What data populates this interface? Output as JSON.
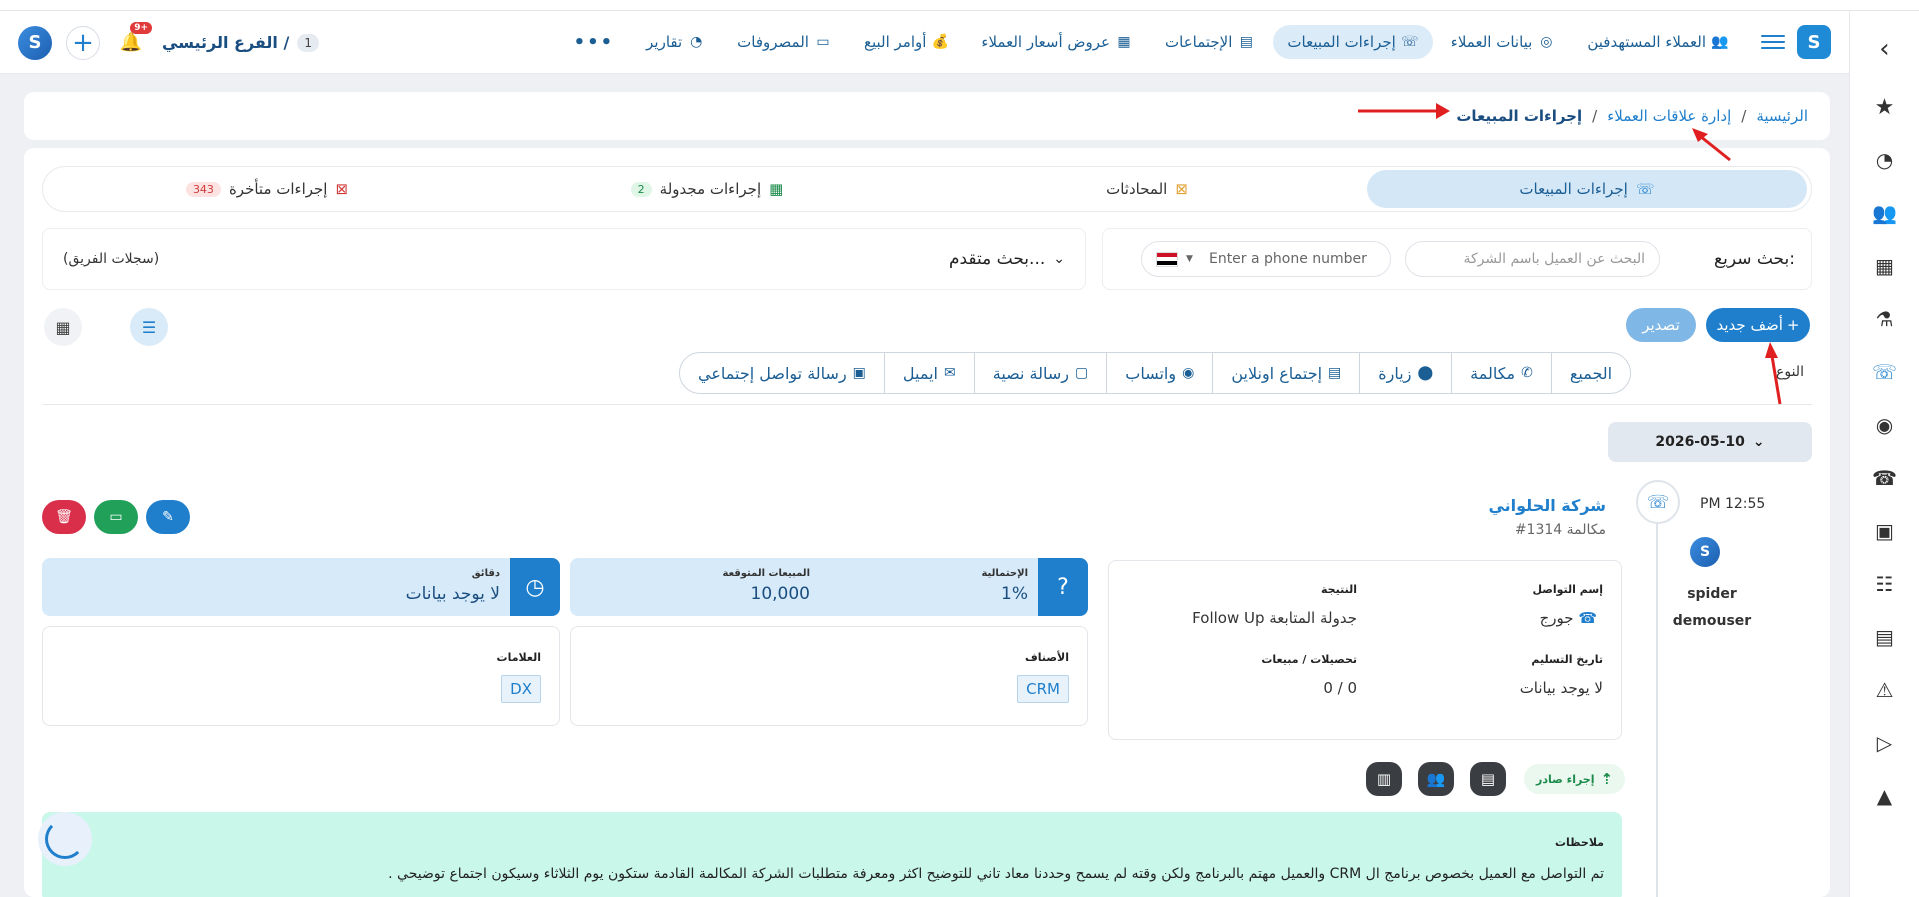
{
  "navbar": {
    "items": [
      {
        "label": "العملاء المستهدفين",
        "icon": "target-users-icon",
        "glyph": "👥"
      },
      {
        "label": "بيانات العملاء",
        "icon": "client-data-icon",
        "glyph": "◎"
      },
      {
        "label": "إجراءات المبيعات",
        "icon": "phone-icon",
        "glyph": "☏",
        "active": true
      },
      {
        "label": "الإجتماعات",
        "icon": "meetings-icon",
        "glyph": "▤"
      },
      {
        "label": "عروض أسعار العملاء",
        "icon": "price-quotes-icon",
        "glyph": "▦"
      },
      {
        "label": "أوامر البيع",
        "icon": "sales-orders-icon",
        "glyph": "💰"
      },
      {
        "label": "المصروفات",
        "icon": "expenses-icon",
        "glyph": "▭"
      },
      {
        "label": "تقارير",
        "icon": "reports-icon",
        "glyph": "◔"
      }
    ],
    "more": "•••",
    "branch_name": "الفرع الرئيسي /",
    "branch_count": "1",
    "notif_badge": "9+"
  },
  "breadcrumb": {
    "home": "الرئيسية",
    "section": "إدارة علاقات العملاء",
    "current": "إجراءات المبيعات",
    "sep": "/"
  },
  "tabs": [
    {
      "label": "إجراءات المبيعات",
      "icon": "phone-icon",
      "glyph": "☏",
      "active": true
    },
    {
      "label": "المحادثات",
      "icon": "chat-off-icon",
      "glyph": "⊠"
    },
    {
      "label": "إجراءات مجدولة",
      "icon": "calendar-icon",
      "glyph": "▦",
      "count": "2"
    },
    {
      "label": "إجراءات متأخرة",
      "icon": "calendar-x-icon",
      "glyph": "⊠",
      "count": "343"
    }
  ],
  "search": {
    "label": "بحث سريع:",
    "company_placeholder": "البحث عن العميل باسم الشركة",
    "phone_placeholder": "Enter a phone number",
    "advanced": "بحث متقدم...",
    "team_records": "(سجلات الفريق)"
  },
  "actions": {
    "add_new": "أضف جديد",
    "export": "تصدير"
  },
  "filters": {
    "type_label": "النوع",
    "chips": [
      {
        "label": "الجميع",
        "icon": ""
      },
      {
        "label": "مكالمة",
        "icon": "call-icon",
        "glyph": "✆"
      },
      {
        "label": "زيارة",
        "icon": "location-icon",
        "glyph": "⬤"
      },
      {
        "label": "إجتماع اونلاين",
        "icon": "presentation-icon",
        "glyph": "▤"
      },
      {
        "label": "واتساب",
        "icon": "whatsapp-icon",
        "glyph": "◉"
      },
      {
        "label": "رسالة نصية",
        "icon": "sms-icon",
        "glyph": "▢"
      },
      {
        "label": "ايميل",
        "icon": "email-icon",
        "glyph": "✉"
      },
      {
        "label": "رسالة تواصل إجتماعي",
        "icon": "social-icon",
        "glyph": "▣"
      }
    ]
  },
  "date_group": "2026-05-10",
  "record": {
    "time": "PM 12:55",
    "user_first": "spider",
    "user_last": "demouser",
    "customer": "شركة الحلواني",
    "sub": "#1314 مكالمة",
    "contact_name_label": "إسم التواصل",
    "contact_name": "جورج",
    "result_label": "النتيجة",
    "result": "Follow Up جدولة المتابعة",
    "delivery_label": "تاريخ التسليم",
    "delivery": "لا يوجد بيانات",
    "collections_label": "تحصيلات / مبيعات",
    "collections": "0 / 0",
    "probability_label": "الإحتمالية",
    "probability": "1%",
    "expected_label": "المبيعات المتوقعة",
    "expected": "10,000",
    "minutes_label": "دقائق",
    "minutes": "لا يوجد بيانات",
    "categories_label": "الأصناف",
    "category_tag": "CRM",
    "tags_label": "العلامات",
    "tag": "DX",
    "direction": "إجراء صادر",
    "notes_label": "ملاحظات",
    "notes": "تم التواصل مع العميل بخصوص برنامج ال CRM والعميل مهتم بالبرنامج ولكن وقته لم يسمح وحددنا معاد تاني للتوضيح اكثر ومعرفة متطلبات الشركة المكالمة القادمة ستكون يوم الثلاثاء وسيكون اجتماع توضيحي ."
  },
  "colors": {
    "primary": "#1f7fcc",
    "active_tab": "#d4e7f7",
    "notes_bg": "#c9f7ea",
    "delete": "#d92f4a",
    "chat": "#21a05a",
    "annotation_arrow": "#e02020"
  }
}
